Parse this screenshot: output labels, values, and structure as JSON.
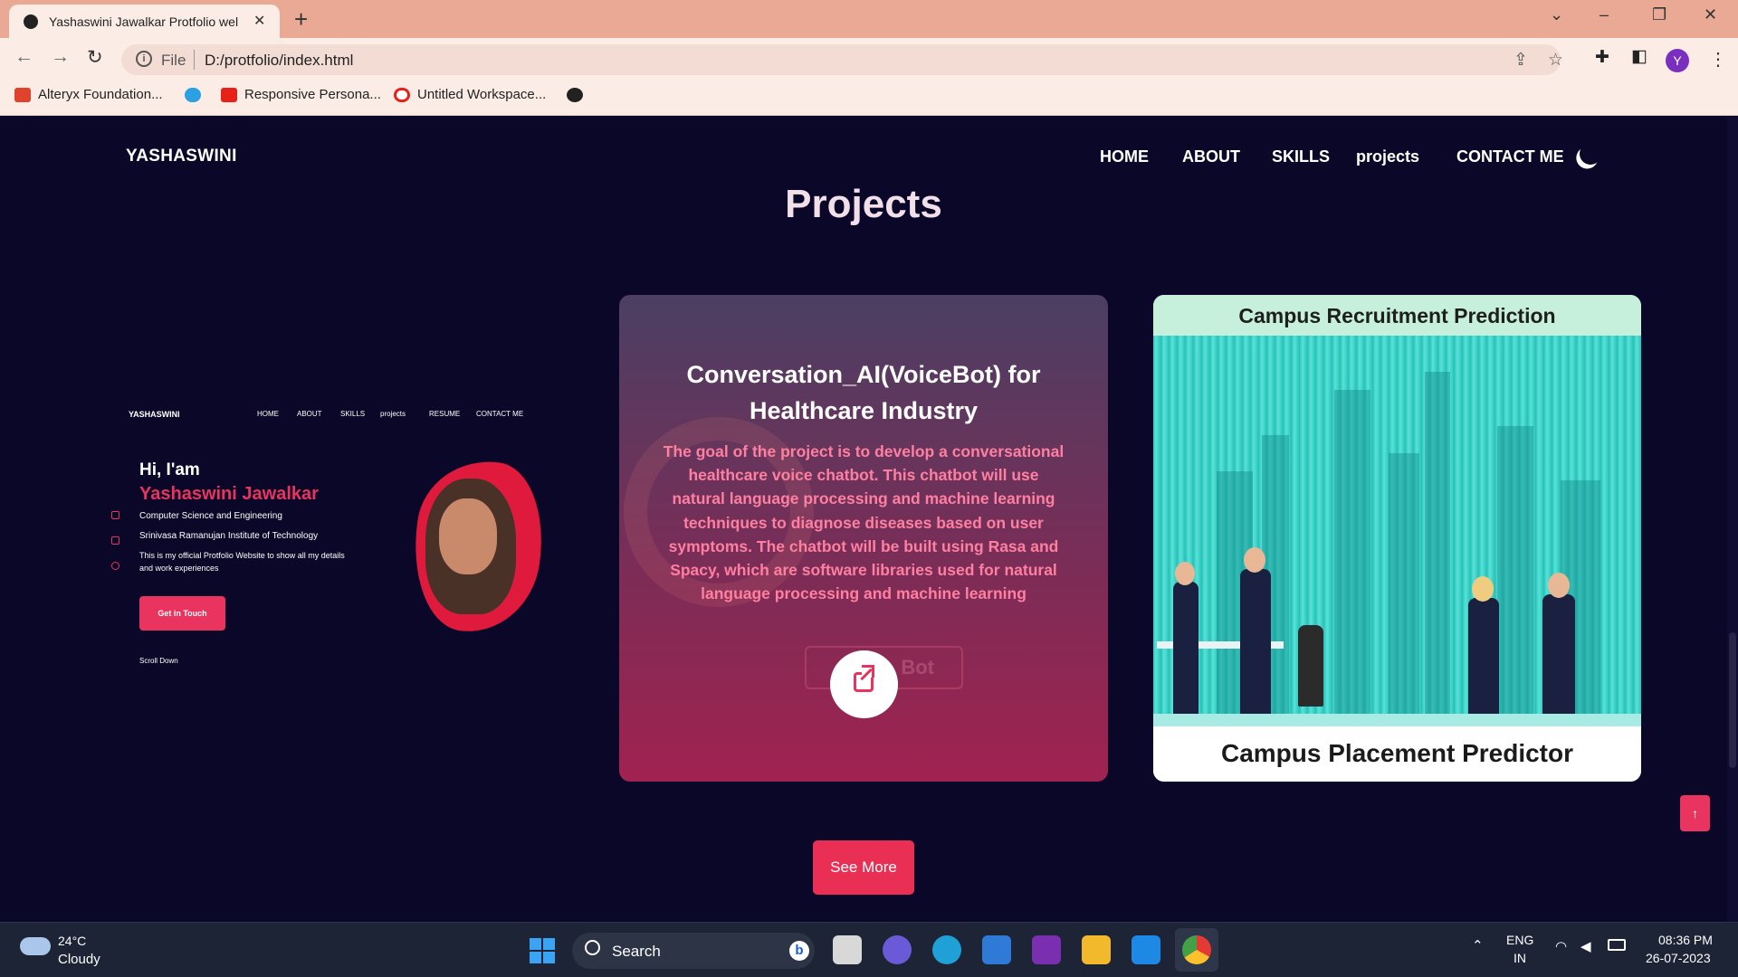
{
  "browser": {
    "tab_title": "Yashaswini Jawalkar Protfolio wel",
    "address_scheme": "File",
    "address_url": "D:/protfolio/index.html",
    "profile_initial": "Y",
    "bookmarks": [
      "Alteryx Foundation...",
      "Responsive Persona...",
      "Untitled Workspace..."
    ]
  },
  "site": {
    "brand": "YASHASWINI",
    "nav": [
      "HOME",
      "ABOUT",
      "SKILLS",
      "projects",
      "CONTACT ME"
    ],
    "section_title": "Projects",
    "thumbnail": {
      "brand": "YASHASWINI",
      "nav": [
        "HOME",
        "ABOUT",
        "SKILLS",
        "projects",
        "RESUME",
        "CONTACT ME"
      ],
      "greeting": "Hi, I'am",
      "name": "Yashaswini Jawalkar",
      "line1": "Computer Science and Engineering",
      "line2": "Srinivasa Ramanujan Institute of Technology",
      "line3": "This is my official Protfolio Website to show all my details",
      "line4": "and work experiences",
      "button": "Get in Touch",
      "scroll": "Scroll Down"
    },
    "project_card": {
      "title": "Conversation_AI(VoiceBot) for Healthcare Industry",
      "description": "The goal of the project is to develop a conversational healthcare voice chatbot. This chatbot will use natural language processing and machine learning techniques to diagnose diseases based on user symptoms. The chatbot will be built using Rasa and Spacy, which are software libraries used for natural language processing and machine learning",
      "ghost_button": "Bot"
    },
    "placement_card": {
      "top_title": "Campus Recruitment Prediction",
      "caption": "Campus Placement Predictor"
    },
    "see_more": "See More",
    "to_top_icon": "arrow-up-icon"
  },
  "taskbar": {
    "temperature": "24°C",
    "weather": "Cloudy",
    "search": "Search",
    "lang1": "ENG",
    "lang2": "IN",
    "time": "08:36 PM",
    "date": "26-07-2023"
  },
  "colors": {
    "accent": "#e8345e",
    "page_bg": "#0b0728",
    "chrome": "#e9a995"
  }
}
